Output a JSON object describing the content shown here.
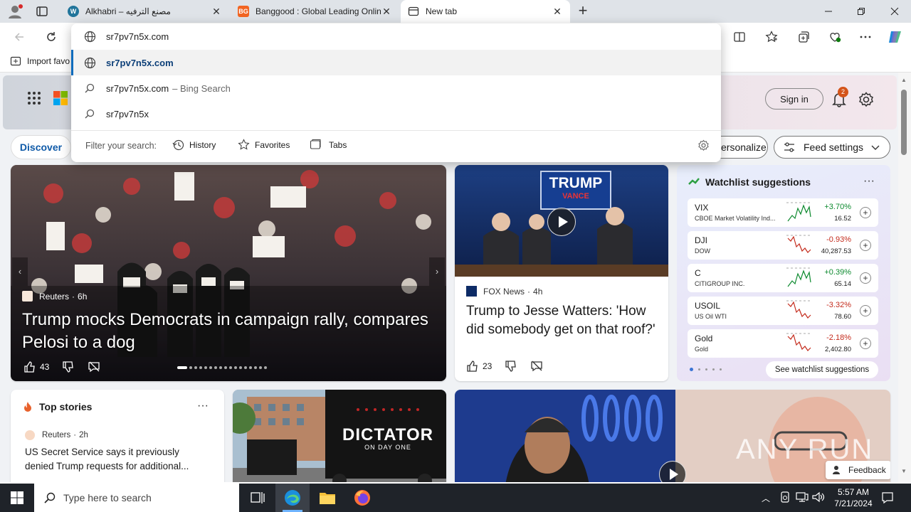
{
  "tabs": [
    {
      "title": "Alkhabri – مصنع الترفيه",
      "favicon": "wordpress-icon"
    },
    {
      "title": "Banggood : Global Leading Onlin",
      "favicon": "banggood-icon"
    },
    {
      "title": "New tab",
      "favicon": "newtab-icon"
    }
  ],
  "toolbar": {
    "favorites_import": "Import favo"
  },
  "omnibox": {
    "value": "sr7pv7n5x.com",
    "suggestions": [
      {
        "text": "sr7pv7n5x.com",
        "suffix": "",
        "icon": "globe-icon"
      },
      {
        "text": "sr7pv7n5x.com",
        "suffix": "– Bing Search",
        "icon": "search-icon"
      },
      {
        "text": "sr7pv7n5x",
        "suffix": "",
        "icon": "search-icon"
      }
    ],
    "filter_label": "Filter your search:",
    "filters": [
      "History",
      "Favorites",
      "Tabs"
    ]
  },
  "header": {
    "sign_in": "Sign in",
    "notification_count": "2"
  },
  "feed": {
    "discover": "Discover",
    "personalize": "ersonalize",
    "feed_settings": "Feed settings"
  },
  "main_story": {
    "source": "Reuters",
    "age": "6h",
    "headline": "Trump mocks Democrats in campaign rally, compares Pelosi to a dog",
    "likes": "43"
  },
  "story2": {
    "source": "FOX News",
    "age": "4h",
    "headline": "Trump to Jesse Watters: 'How did somebody get on that roof?'",
    "likes": "23",
    "image_sign": "TRUMP",
    "image_sign2": "VANCE"
  },
  "watchlist": {
    "title": "Watchlist suggestions",
    "items": [
      {
        "symbol": "VIX",
        "name": "CBOE Market Volatility Ind...",
        "change": "+3.70%",
        "price": "16.52",
        "up": true
      },
      {
        "symbol": "DJI",
        "name": "DOW",
        "change": "-0.93%",
        "price": "40,287.53",
        "up": false
      },
      {
        "symbol": "C",
        "name": "CITIGROUP INC.",
        "change": "+0.39%",
        "price": "65.14",
        "up": true
      },
      {
        "symbol": "USOIL",
        "name": "US Oil WTI",
        "change": "-3.32%",
        "price": "78.60",
        "up": false
      },
      {
        "symbol": "Gold",
        "name": "Gold",
        "change": "-2.18%",
        "price": "2,402.80",
        "up": false
      }
    ],
    "see_more": "See watchlist suggestions",
    "colors": {
      "up": "#0d8a2f",
      "down": "#c42b1c"
    }
  },
  "top_stories": {
    "title": "Top stories",
    "source": "Reuters",
    "age": "2h",
    "headline": "US Secret Service says it previously denied Trump requests for additional..."
  },
  "image_card": {
    "sign_line1": "DICTATOR",
    "sign_line2": "ON DAY ONE"
  },
  "feedback": "Feedback",
  "watermark": "ANY RUN",
  "taskbar": {
    "search_placeholder": "Type here to search",
    "time": "5:57 AM",
    "date": "7/21/2024"
  }
}
